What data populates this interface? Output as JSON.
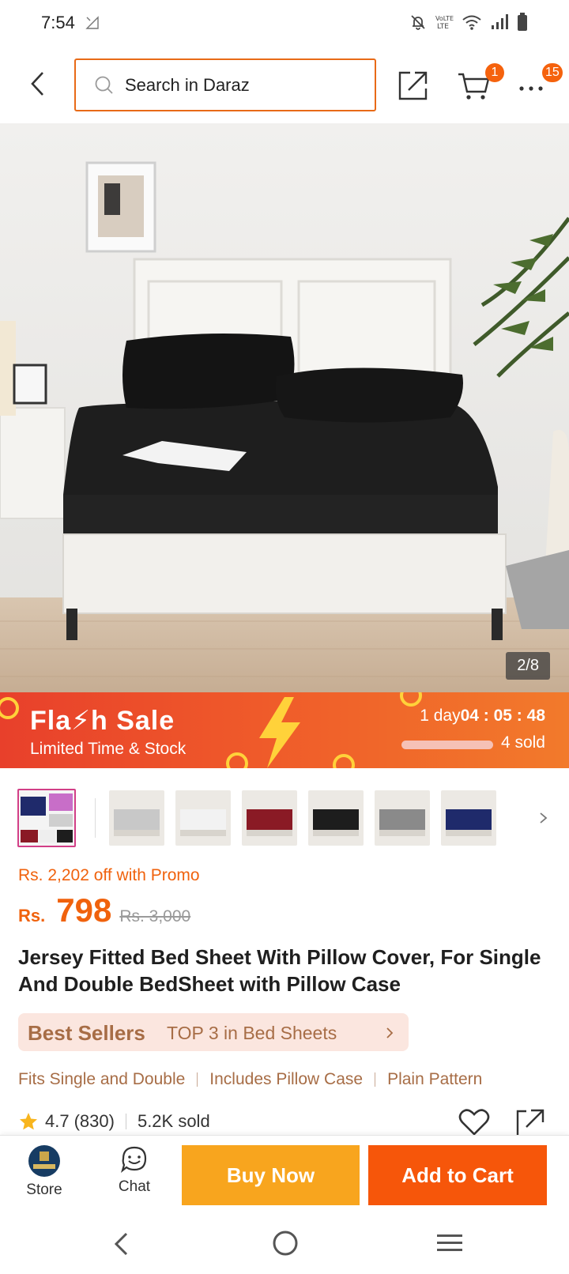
{
  "status_bar": {
    "time": "7:54"
  },
  "header": {
    "search_placeholder": "Search in Daraz",
    "cart_count": "1",
    "more_count": "15"
  },
  "gallery": {
    "counter": "2/8",
    "thumbnail_colors": [
      "#c8c8c8",
      "#f2f2f2",
      "#8a1a25",
      "#1d1d1d",
      "#8a8a8a",
      "#1f2a6b"
    ]
  },
  "flash_sale": {
    "title": "Fla⚡h  Sale",
    "subtitle": "Limited Time & Stock",
    "days_label": "1 day",
    "countdown": "04 : 05 : 48",
    "sold": "4 sold"
  },
  "price": {
    "promo": "Rs. 2,202 off with Promo",
    "currency": "Rs.",
    "current": "798",
    "original": "Rs. 3,000"
  },
  "product": {
    "title": "Jersey Fitted Bed Sheet With Pillow Cover, For Single And Double BedSheet with Pillow Case"
  },
  "best_seller": {
    "label": "Best Sellers",
    "rank": "TOP 3 in Bed Sheets"
  },
  "tags": [
    "Fits Single and Double",
    "Includes Pillow Case",
    "Plain Pattern"
  ],
  "rating": {
    "score": "4.7",
    "count": "(830)",
    "sold": "5.2K sold"
  },
  "bottom_bar": {
    "store_label": "Store",
    "chat_label": "Chat",
    "buy_now": "Buy Now",
    "add_to_cart": "Add to Cart"
  },
  "colors": {
    "brand_orange": "#f6560a",
    "buy_now_yellow": "#f8a51e",
    "price_orange": "#f0620d",
    "search_border": "#e86a17"
  }
}
